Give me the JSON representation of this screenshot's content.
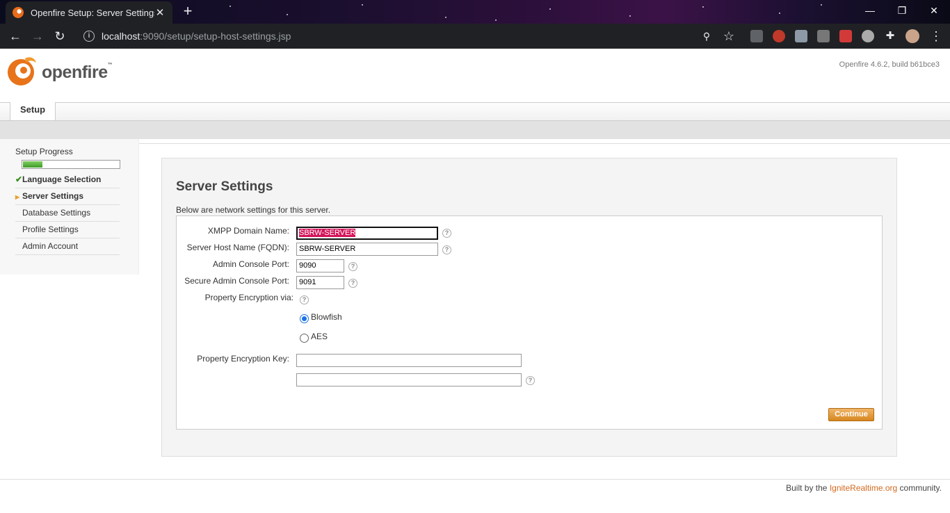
{
  "browser": {
    "tab_title": "Openfire Setup: Server Settings",
    "url_host": "localhost",
    "url_rest": ":9090/setup/setup-host-settings.jsp"
  },
  "header": {
    "logo_text": "openfire",
    "logo_tm": "™",
    "version": "Openfire 4.6.2, build b61bce3"
  },
  "tabs": {
    "setup": "Setup"
  },
  "sidebar": {
    "progress_title": "Setup Progress",
    "progress_fraction": 0.2,
    "steps": [
      {
        "label": "Language Selection",
        "state": "done"
      },
      {
        "label": "Server Settings",
        "state": "current"
      },
      {
        "label": "Database Settings",
        "state": "pending"
      },
      {
        "label": "Profile Settings",
        "state": "pending"
      },
      {
        "label": "Admin Account",
        "state": "pending"
      }
    ]
  },
  "main": {
    "title": "Server Settings",
    "description": "Below are network settings for this server.",
    "fields": {
      "domain_label": "XMPP Domain Name:",
      "domain_value": "SBRW-SERVER",
      "fqdn_label": "Server Host Name (FQDN):",
      "fqdn_value": "SBRW-SERVER",
      "port_label": "Admin Console Port:",
      "port_value": "9090",
      "secure_port_label": "Secure Admin Console Port:",
      "secure_port_value": "9091",
      "encryption_label": "Property Encryption via:",
      "option_blowfish": "Blowfish",
      "option_aes": "AES",
      "key_label": "Property Encryption Key:",
      "key_value": "",
      "key_confirm_value": ""
    },
    "continue_label": "Continue"
  },
  "footer": {
    "prefix": "Built by the ",
    "link": "IgniteRealtime.org",
    "suffix": " community."
  },
  "colors": {
    "accent": "#d7871f",
    "selection": "#d4145a",
    "progress": "#3e9b26"
  }
}
